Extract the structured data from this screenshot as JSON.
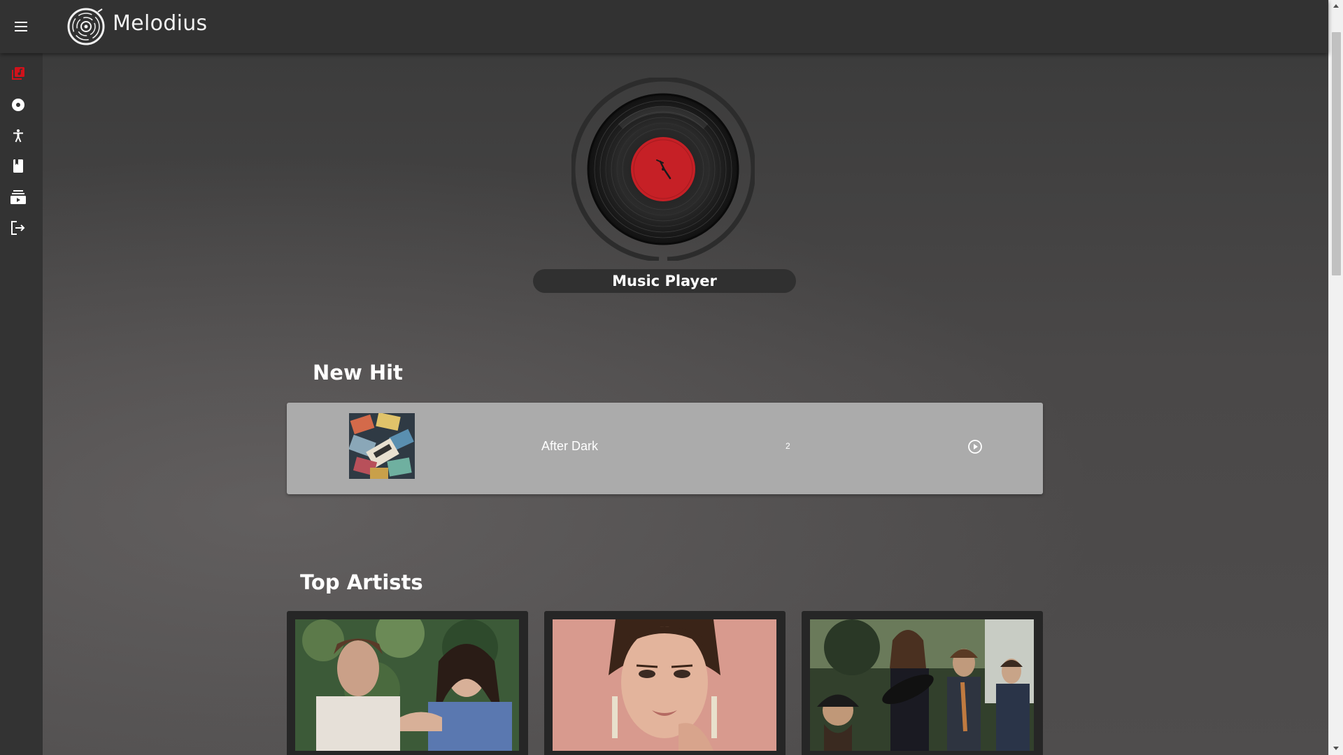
{
  "app": {
    "name": "Melodius"
  },
  "header": {
    "menu_icon": "hamburger-menu-icon",
    "logo_icon": "vinyl-logo-icon"
  },
  "sidebar": {
    "items": [
      {
        "icon": "library-music-icon",
        "active": true
      },
      {
        "icon": "album-icon",
        "active": false
      },
      {
        "icon": "artist-figure-icon",
        "active": false
      },
      {
        "icon": "book-icon",
        "active": false
      },
      {
        "icon": "playlist-stack-icon",
        "active": false
      },
      {
        "icon": "logout-icon",
        "active": false
      }
    ]
  },
  "hero": {
    "title": "Music Player"
  },
  "new_hit": {
    "heading": "New Hit",
    "track": {
      "title": "After Dark",
      "count": "2",
      "play_icon": "play-circle-icon"
    }
  },
  "top_artists": {
    "heading": "Top Artists",
    "artists": [
      {
        "image": "duo-artist-photo"
      },
      {
        "image": "female-singer-photo"
      },
      {
        "image": "band-group-photo"
      }
    ]
  },
  "colors": {
    "accent": "#d0121b",
    "topbar": "#323232",
    "sidebar": "#333333",
    "card": "#ababab",
    "vinyl_label": "#c62026"
  }
}
